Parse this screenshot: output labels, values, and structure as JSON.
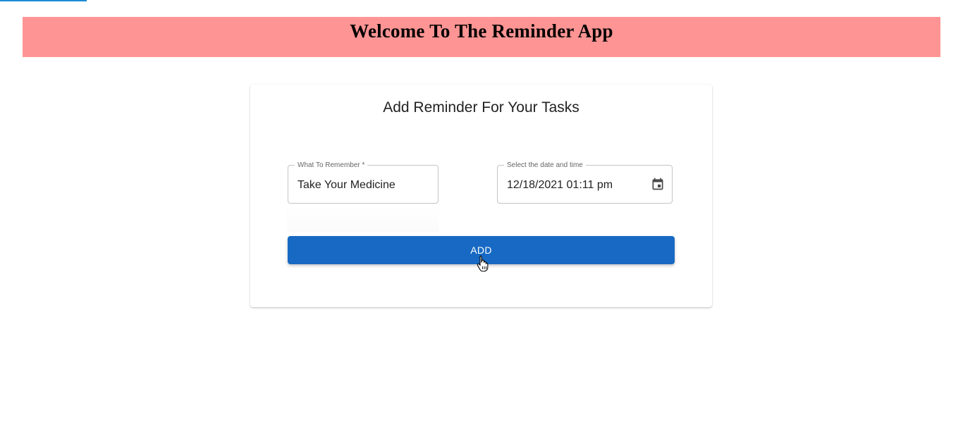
{
  "header": {
    "title": "Welcome To The Reminder App",
    "background_color": "#ff9494"
  },
  "card": {
    "title": "Add Reminder For Your Tasks"
  },
  "form": {
    "task_field": {
      "label": "What To Remember *",
      "value": "Take Your Medicine"
    },
    "date_field": {
      "label": "Select the date and time",
      "value": "12/18/2021 01:11 pm",
      "icon": "calendar-icon"
    },
    "add_button": {
      "label": "ADD",
      "color": "#1769c3"
    }
  },
  "cursor": {
    "icon": "hand-pointer-cursor"
  }
}
